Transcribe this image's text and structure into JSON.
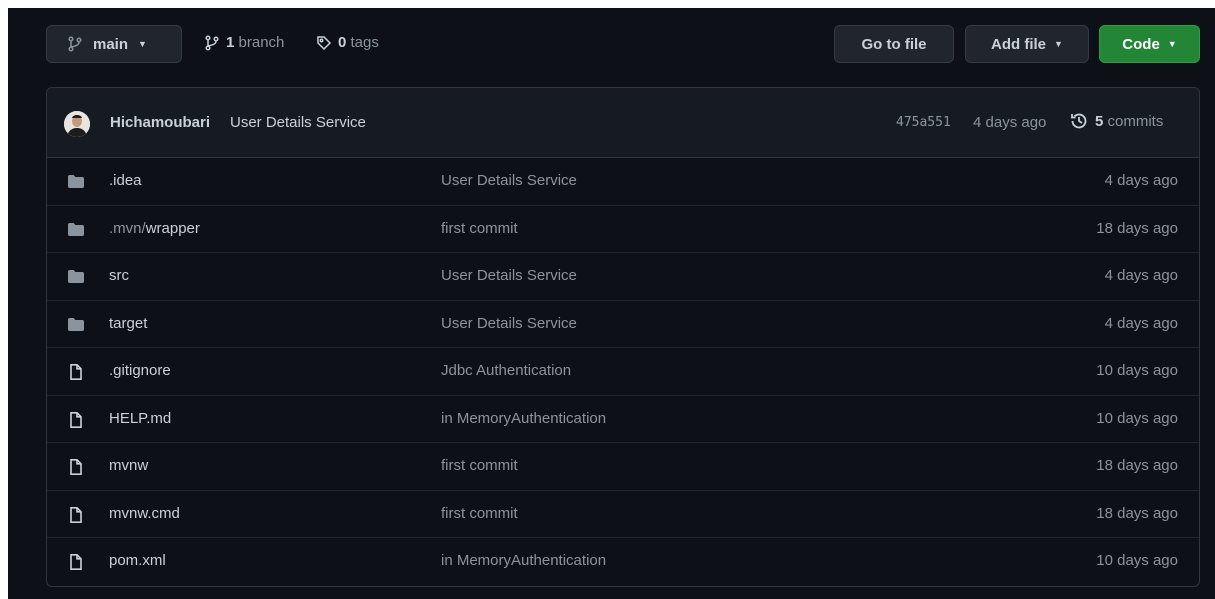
{
  "toolbar": {
    "branch_name": "main",
    "branches_count": "1",
    "branches_label": "branch",
    "tags_count": "0",
    "tags_label": "tags",
    "goto_file_label": "Go to file",
    "add_file_label": "Add file",
    "code_label": "Code"
  },
  "commit": {
    "author": "Hichamoubari",
    "message": "User Details Service",
    "sha": "475a551",
    "date": "4 days ago",
    "commits_count": "5",
    "commits_label": "commits"
  },
  "files": [
    {
      "type": "folder",
      "name_prefix": "",
      "name": ".idea",
      "message": "User Details Service",
      "age": "4 days ago"
    },
    {
      "type": "folder",
      "name_prefix": ".mvn/",
      "name": "wrapper",
      "message": "first commit",
      "age": "18 days ago"
    },
    {
      "type": "folder",
      "name_prefix": "",
      "name": "src",
      "message": "User Details Service",
      "age": "4 days ago"
    },
    {
      "type": "folder",
      "name_prefix": "",
      "name": "target",
      "message": "User Details Service",
      "age": "4 days ago"
    },
    {
      "type": "file",
      "name_prefix": "",
      "name": ".gitignore",
      "message": "Jdbc Authentication",
      "age": "10 days ago"
    },
    {
      "type": "file",
      "name_prefix": "",
      "name": "HELP.md",
      "message": "in MemoryAuthentication",
      "age": "10 days ago"
    },
    {
      "type": "file",
      "name_prefix": "",
      "name": "mvnw",
      "message": "first commit",
      "age": "18 days ago"
    },
    {
      "type": "file",
      "name_prefix": "",
      "name": "mvnw.cmd",
      "message": "first commit",
      "age": "18 days ago"
    },
    {
      "type": "file",
      "name_prefix": "",
      "name": "pom.xml",
      "message": "in MemoryAuthentication",
      "age": "10 days ago"
    }
  ],
  "colors": {
    "background": "#0d1117",
    "header_background": "#161b22",
    "border": "#30363d",
    "code_button": "#238636",
    "folder_icon": "#8b949e",
    "text_primary": "#c9d1d9",
    "text_muted": "#8b949e"
  },
  "icons": {
    "branch": "git-branch-icon",
    "tag": "tag-icon",
    "history": "history-icon",
    "folder": "folder-icon",
    "file": "file-icon"
  }
}
